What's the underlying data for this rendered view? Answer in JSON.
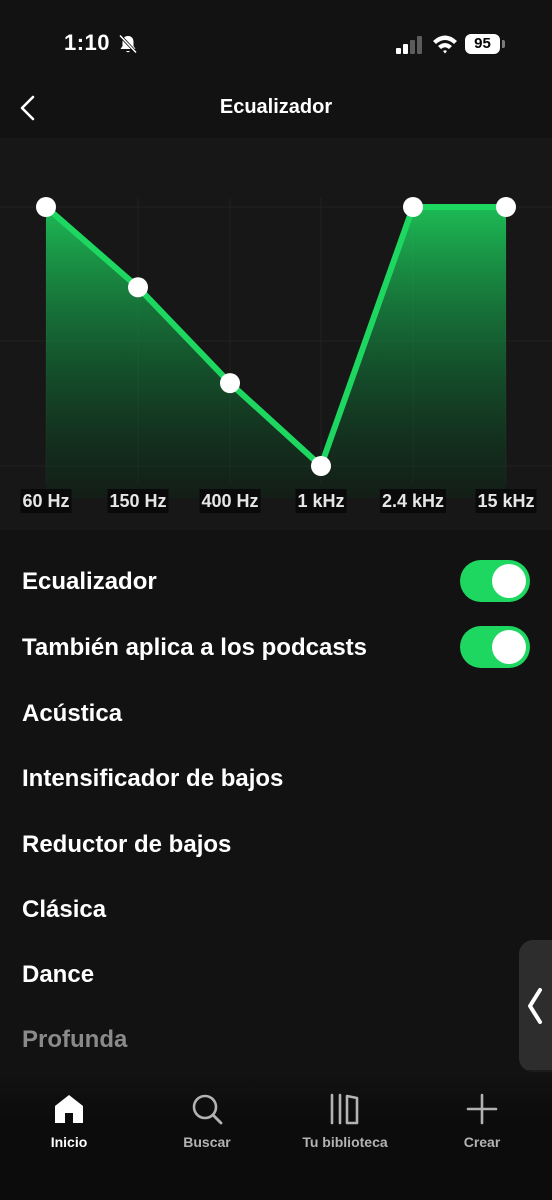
{
  "status_bar": {
    "time": "1:10",
    "battery": "95"
  },
  "header": {
    "title": "Ecualizador"
  },
  "equalizer": {
    "bands": [
      {
        "label": "60 Hz",
        "level": 1.0
      },
      {
        "label": "150 Hz",
        "level": 0.69
      },
      {
        "label": "400 Hz",
        "level": 0.32
      },
      {
        "label": "1 kHz",
        "level": 0.0
      },
      {
        "label": "2.4 kHz",
        "level": 1.0
      },
      {
        "label": "15 kHz",
        "level": 1.0
      }
    ],
    "accent": "#1ed760"
  },
  "settings": {
    "equalizer_label": "Ecualizador",
    "equalizer_on": true,
    "podcasts_label": "También aplica a los podcasts",
    "podcasts_on": true,
    "presets": [
      "Acústica",
      "Intensificador de bajos",
      "Reductor de bajos",
      "Clásica",
      "Dance",
      "Profunda"
    ]
  },
  "nav": {
    "items": [
      {
        "label": "Inicio",
        "icon": "home-icon",
        "active": true
      },
      {
        "label": "Buscar",
        "icon": "search-icon",
        "active": false
      },
      {
        "label": "Tu biblioteca",
        "icon": "library-icon",
        "active": false
      },
      {
        "label": "Crear",
        "icon": "plus-icon",
        "active": false
      }
    ]
  }
}
